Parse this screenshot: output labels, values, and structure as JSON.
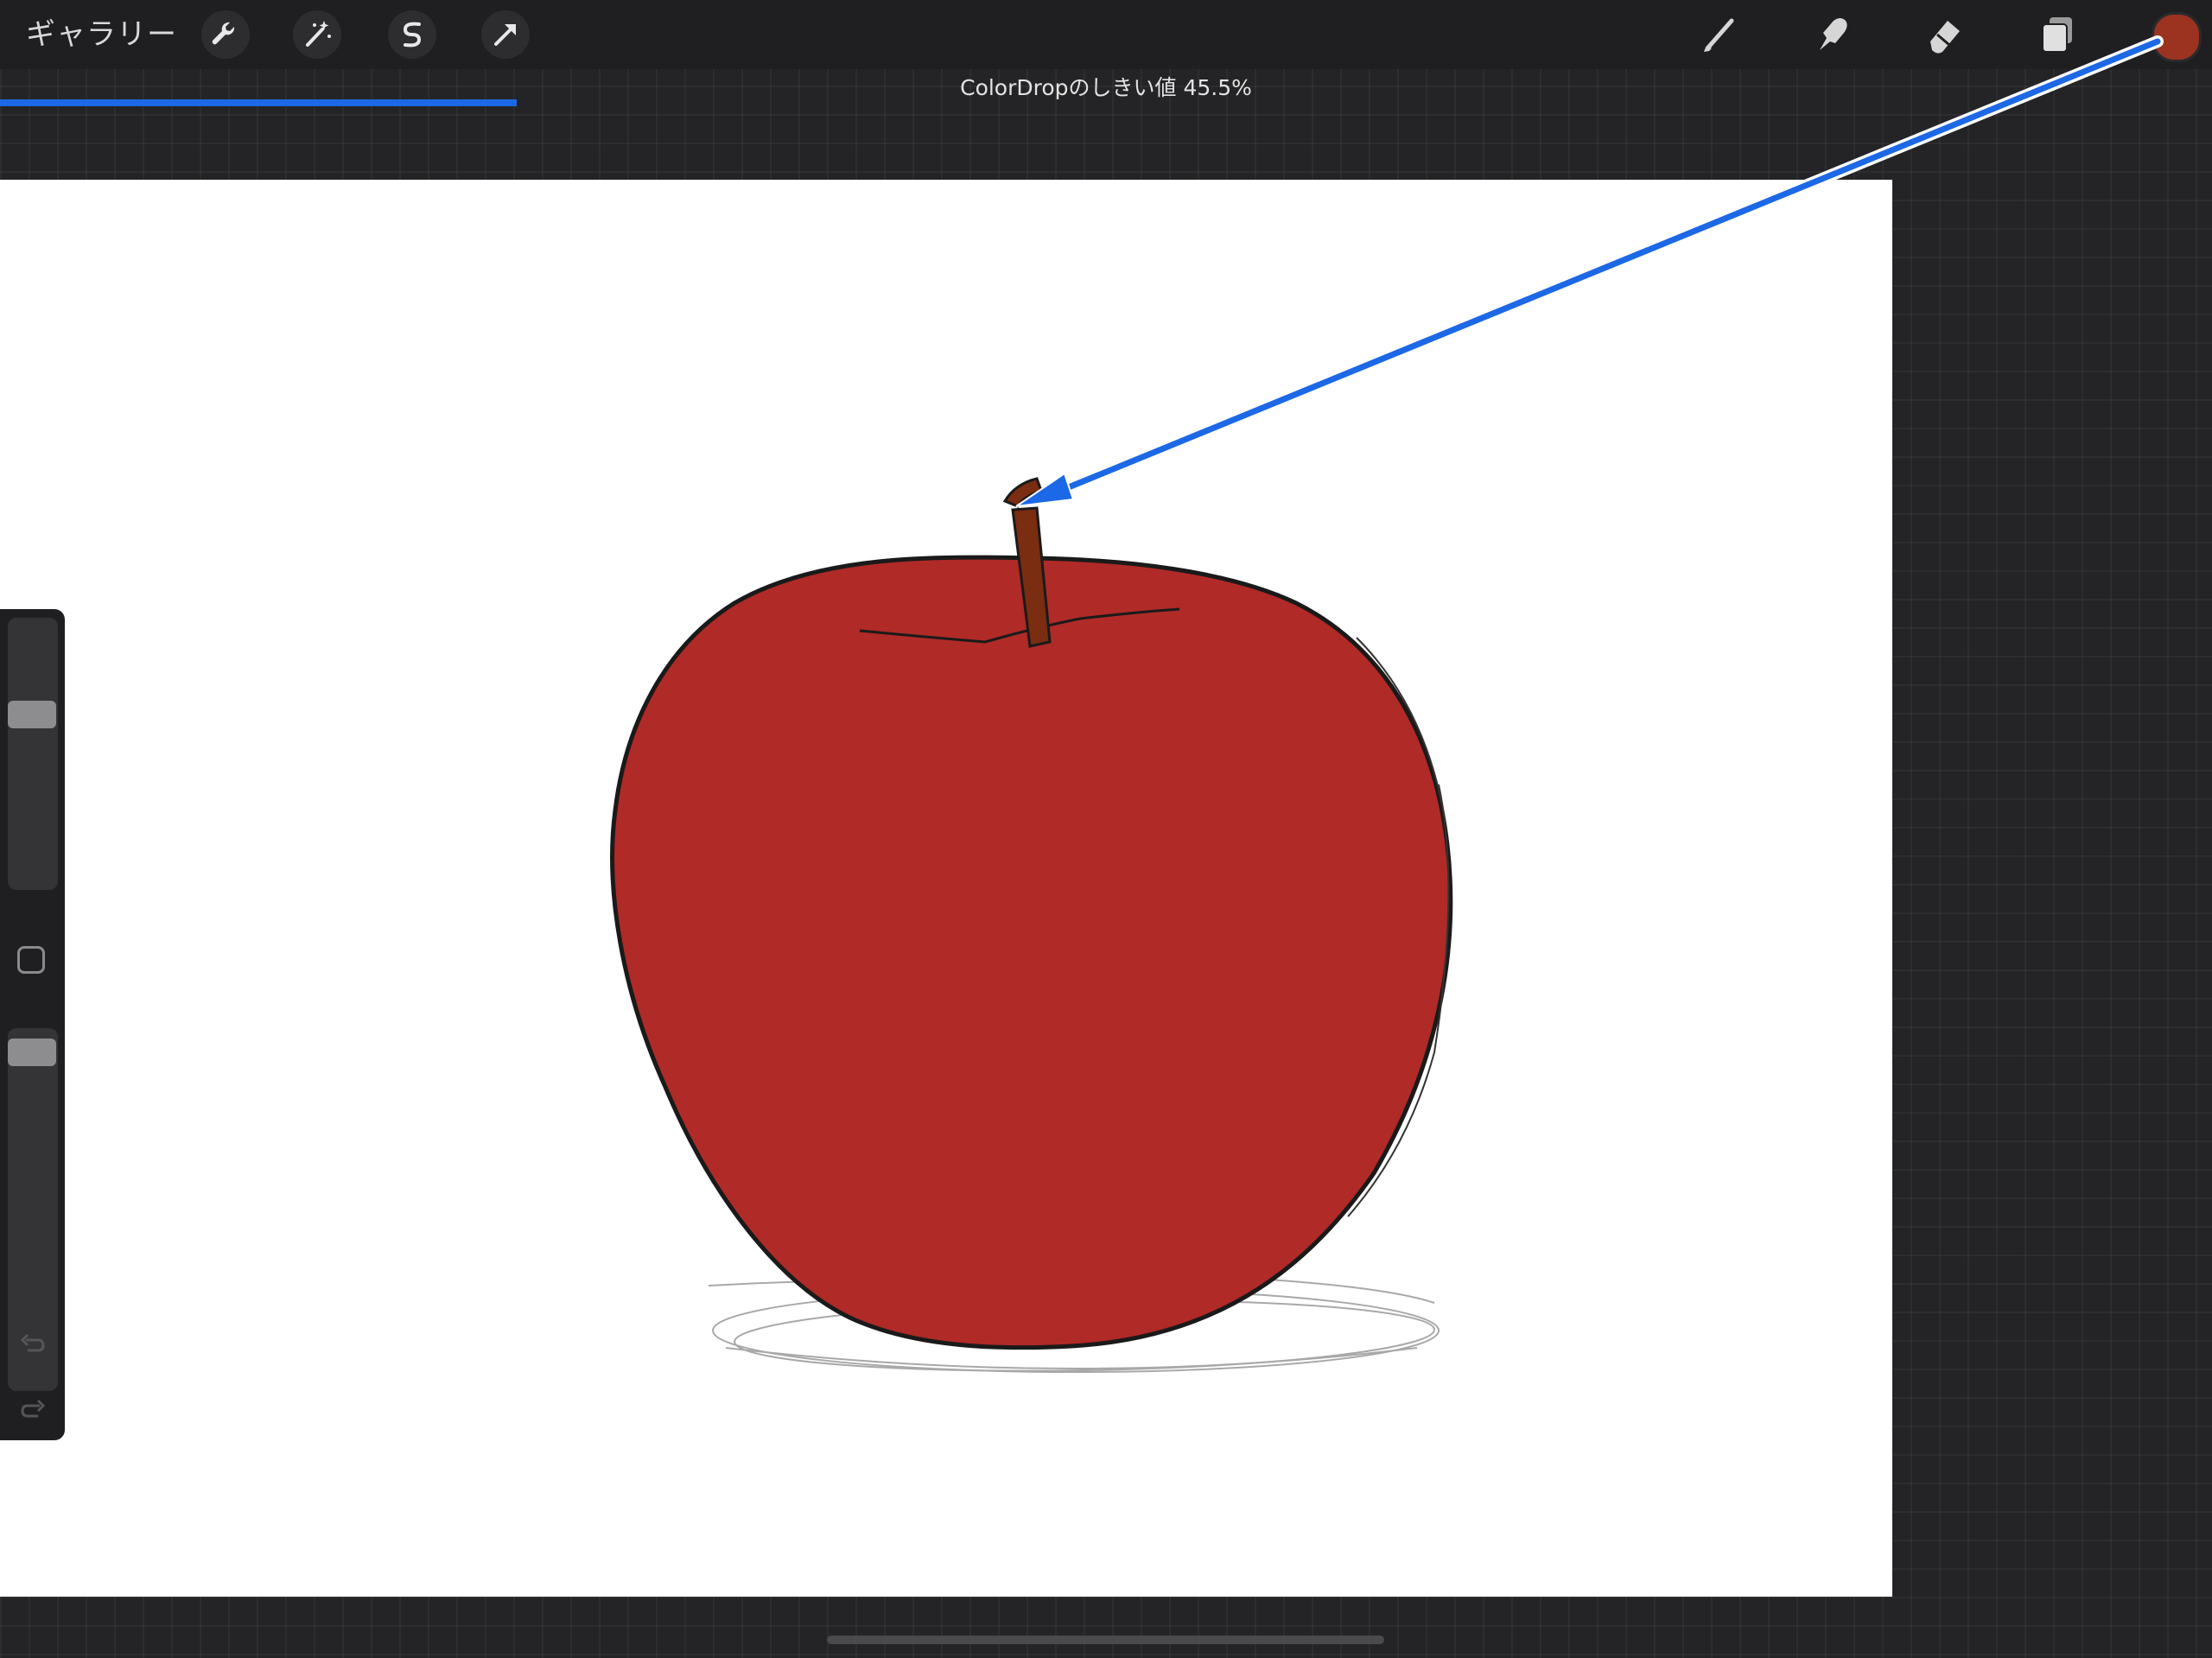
{
  "topbar": {
    "gallery_label": "ギャラリー",
    "left_tools": [
      {
        "name": "actions",
        "icon": "wrench-icon"
      },
      {
        "name": "adjustments",
        "icon": "magic-wand-icon"
      },
      {
        "name": "selection",
        "icon": "selection-s-icon"
      },
      {
        "name": "transform",
        "icon": "transform-arrow-icon"
      }
    ],
    "right_tools": [
      {
        "name": "paint",
        "icon": "brush-icon"
      },
      {
        "name": "smudge",
        "icon": "smudge-finger-icon"
      },
      {
        "name": "erase",
        "icon": "eraser-icon"
      },
      {
        "name": "layers",
        "icon": "layers-icon"
      }
    ],
    "current_color": "#9b3320"
  },
  "threshold": {
    "label": "ColorDropのしきい値 45.5%",
    "fill_fraction": 0.455,
    "bar_color": "#1c68e6"
  },
  "canvas": {
    "apple_fill": "#b02a27",
    "stem_color": "#7a2d10",
    "outline_color": "#1a1a1a"
  },
  "sidebar": {
    "brush_size_level": 0.66,
    "opacity_level": 0.97,
    "undo_icon": "undo-icon",
    "redo_icon": "redo-icon"
  },
  "annotation": {
    "arrow_color": "#1c68e6"
  }
}
